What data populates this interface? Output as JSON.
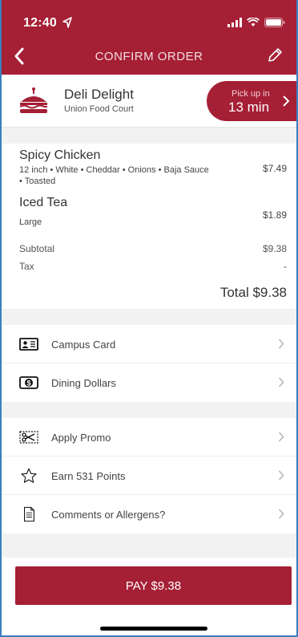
{
  "status_bar": {
    "time": "12:40"
  },
  "nav": {
    "title": "CONFIRM ORDER"
  },
  "restaurant": {
    "name": "Deli Delight",
    "location": "Union Food Court",
    "pickup_label": "Pick up in",
    "pickup_time": "13 min"
  },
  "order": {
    "items": [
      {
        "name": "Spicy Chicken",
        "desc_line1": "12 inch • White • Cheddar • Onions • Baja Sauce",
        "desc_line2": "• Toasted",
        "price": "$7.49"
      },
      {
        "name": "Iced Tea",
        "desc_line1": "Large",
        "price": "$1.89"
      }
    ],
    "subtotal_label": "Subtotal",
    "subtotal_value": "$9.38",
    "tax_label": "Tax",
    "tax_value": "-",
    "total": "Total $9.38"
  },
  "payment_methods": [
    {
      "label": "Campus Card",
      "icon": "id-card-icon"
    },
    {
      "label": "Dining Dollars",
      "icon": "dollar-bill-icon"
    }
  ],
  "extras": [
    {
      "label": "Apply Promo",
      "icon": "coupon-scissors-icon"
    },
    {
      "label": "Earn 531 Points",
      "icon": "star-icon"
    },
    {
      "label": "Comments or Allergens?",
      "icon": "document-icon"
    }
  ],
  "pay_button": {
    "label": "PAY $9.38"
  },
  "colors": {
    "brand": "#a51f35",
    "background": "#f2f2f2"
  }
}
